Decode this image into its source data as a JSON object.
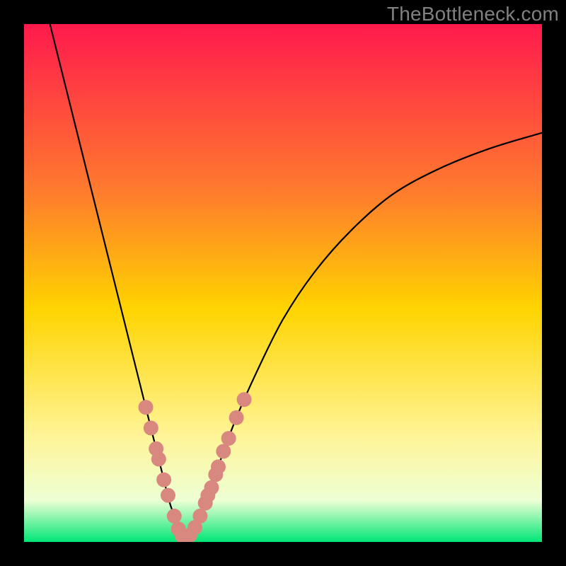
{
  "watermark": "TheBottleneck.com",
  "colors": {
    "gradient_top": "#ff1a4d",
    "gradient_mid_upper": "#ff7a2e",
    "gradient_mid": "#ffd400",
    "gradient_lower": "#fff59a",
    "gradient_pale": "#edffd4",
    "gradient_bottom": "#00e676",
    "curve": "#000000",
    "marker_fill": "#d98880",
    "marker_stroke": "#c0392b"
  },
  "chart_data": {
    "type": "line",
    "title": "",
    "xlabel": "",
    "ylabel": "",
    "xlim": [
      0,
      100
    ],
    "ylim": [
      0,
      100
    ],
    "series": [
      {
        "name": "bottleneck-curve",
        "x": [
          5,
          8,
          11,
          14,
          17,
          19,
          21,
          23,
          25,
          26.5,
          28,
          29,
          30,
          30.6,
          31.2,
          32.5,
          34,
          36,
          38,
          41,
          45,
          50,
          56,
          63,
          71,
          80,
          90,
          100
        ],
        "y": [
          100,
          88,
          76,
          64,
          52,
          44,
          36,
          28,
          20,
          14,
          8,
          5,
          2,
          1,
          1,
          2,
          5,
          10,
          16,
          24,
          33,
          43,
          52,
          60,
          67,
          72,
          76,
          79
        ]
      }
    ],
    "markers": {
      "name": "highlighted-points",
      "points": [
        {
          "x": 23.5,
          "y": 26
        },
        {
          "x": 24.5,
          "y": 22
        },
        {
          "x": 25.5,
          "y": 18
        },
        {
          "x": 26.0,
          "y": 16
        },
        {
          "x": 27.0,
          "y": 12
        },
        {
          "x": 27.8,
          "y": 9
        },
        {
          "x": 29.0,
          "y": 5
        },
        {
          "x": 29.8,
          "y": 2.5
        },
        {
          "x": 30.5,
          "y": 1.2
        },
        {
          "x": 31.2,
          "y": 1.0
        },
        {
          "x": 32.0,
          "y": 1.3
        },
        {
          "x": 33.0,
          "y": 2.8
        },
        {
          "x": 34.0,
          "y": 5
        },
        {
          "x": 35.0,
          "y": 7.5
        },
        {
          "x": 35.5,
          "y": 9
        },
        {
          "x": 36.2,
          "y": 10.5
        },
        {
          "x": 37.0,
          "y": 13
        },
        {
          "x": 37.5,
          "y": 14.5
        },
        {
          "x": 38.5,
          "y": 17.5
        },
        {
          "x": 39.5,
          "y": 20
        },
        {
          "x": 41.0,
          "y": 24
        },
        {
          "x": 42.5,
          "y": 27.5
        }
      ]
    }
  }
}
